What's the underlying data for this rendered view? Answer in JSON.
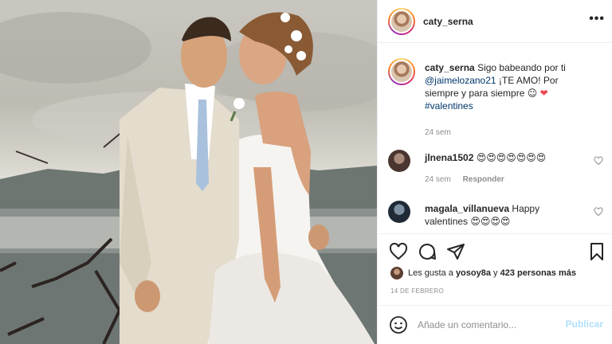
{
  "post": {
    "author": "caty_serna",
    "more_icon": "more-options-icon",
    "caption": {
      "user": "caty_serna",
      "text_a": "Sigo babeando por ti",
      "mention": "@jaimelozano21",
      "text_b": "¡TE AMO! Por siempre y para siempre",
      "emoji": "☺",
      "heart": "❤",
      "hashtag": "#valentines",
      "time": "24 sem"
    },
    "comments": [
      {
        "user": "jlnena1502",
        "text": "😍😍😍😍😍😍😍",
        "time": "24 sem",
        "reply": "Responder"
      },
      {
        "user": "magala_villanueva",
        "text": "Happy valentines",
        "emojis": "😍😍😍😍"
      }
    ],
    "likes": {
      "prefix": "Les gusta a",
      "user": "yosoy8a",
      "joiner": "y",
      "count_text": "423 personas más"
    },
    "date": "14 DE FEBRERO",
    "add_comment": {
      "placeholder": "Añade un comentario...",
      "publish": "Publicar"
    }
  },
  "colors": {
    "accent": "#0095f6",
    "publish_disabled": "#b2dffc",
    "like_red": "#ed4956",
    "meta_gray": "#8e8e8e"
  }
}
